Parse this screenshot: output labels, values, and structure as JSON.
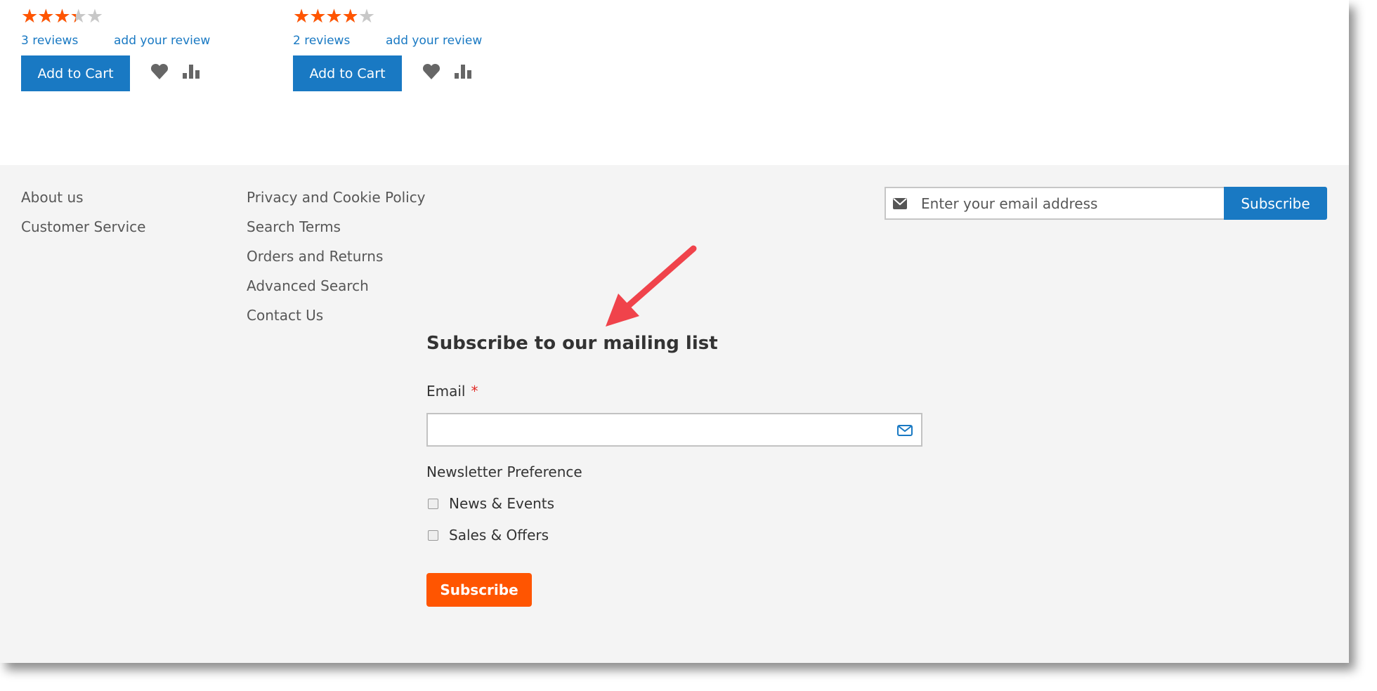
{
  "products": [
    {
      "rating_percent": 60,
      "reviews": "3  reviews",
      "add_review": "add your review",
      "add_to_cart": "Add to Cart"
    },
    {
      "rating_percent": 70,
      "reviews": "2  reviews",
      "add_review": "add your review",
      "add_to_cart": "Add to Cart"
    }
  ],
  "footer": {
    "col1": [
      "About us",
      "Customer Service"
    ],
    "col2": [
      "Privacy and Cookie Policy",
      "Search Terms",
      "Orders and Returns",
      "Advanced Search",
      "Contact Us"
    ],
    "newsletter": {
      "placeholder": "Enter your email address",
      "button": "Subscribe",
      "icon": "envelope-icon"
    }
  },
  "form": {
    "title": "Subscribe to our mailing list",
    "email_label": "Email",
    "required_mark": "*",
    "email_value": "",
    "preference_label": "Newsletter Preference",
    "options": [
      "News & Events",
      "Sales & Offers"
    ],
    "submit": "Subscribe"
  },
  "colors": {
    "primary": "#1979c3",
    "accent": "#ff5501",
    "annotation_arrow": "#f0434b"
  }
}
